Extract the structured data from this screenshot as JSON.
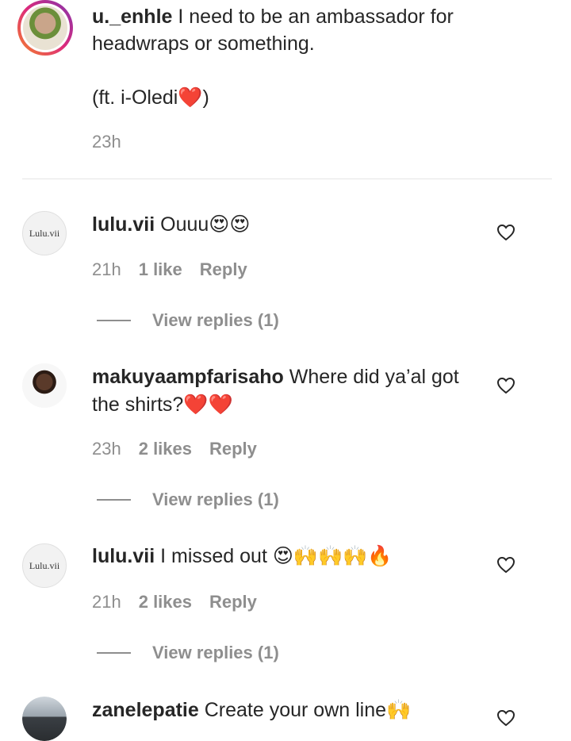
{
  "caption": {
    "username": "u._enhle",
    "text_line1": " I need to be an ambassador for",
    "text_line2": "headwraps or something.",
    "text_line3": "(ft. i-Oledi❤️)",
    "time": "23h"
  },
  "comments": [
    {
      "username": "lulu.vii",
      "avatar_text": "Lulu.vii",
      "text_line1": " Ouuu😍😍",
      "text_line2": "",
      "time": "21h",
      "likes": "1 like",
      "reply": "Reply",
      "view_replies": "View replies (1)"
    },
    {
      "username": "makuyaampfarisaho",
      "avatar_text": "",
      "text_line1": " Where did ya’al got",
      "text_line2": "the shirts?❤️❤️",
      "time": "23h",
      "likes": "2 likes",
      "reply": "Reply",
      "view_replies": "View replies (1)"
    },
    {
      "username": "lulu.vii",
      "avatar_text": "Lulu.vii",
      "text_line1": " I missed out 😍🙌🙌🙌🔥",
      "text_line2": "",
      "time": "21h",
      "likes": "2 likes",
      "reply": "Reply",
      "view_replies": "View replies (1)"
    },
    {
      "username": "zanelepatie",
      "avatar_text": "",
      "text_line1": " Create your own line🙌",
      "text_line2": ""
    }
  ],
  "icons": {
    "like": "heart-outline-icon"
  },
  "colors": {
    "text": "#262626",
    "secondary": "#8e8e8e",
    "story_ring_start": "#f58529",
    "story_ring_end": "#dd2a7b"
  }
}
